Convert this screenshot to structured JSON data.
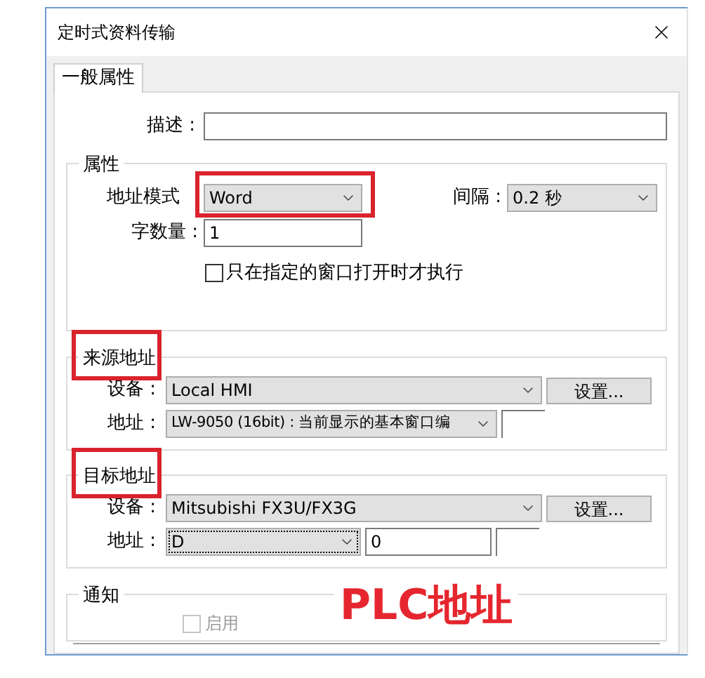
{
  "window": {
    "title": "定时式资料传输"
  },
  "tabs": [
    {
      "label": "一般属性",
      "selected": true
    }
  ],
  "description": {
    "label": "描述 :"
  },
  "properties": {
    "title": "属性",
    "address_mode": {
      "label": "地址模式",
      "value": "Word",
      "highlighted": true
    },
    "interval": {
      "label": "间隔 :",
      "value": "0.2 秒"
    },
    "word_count": {
      "label": "字数量 :",
      "value": "1"
    },
    "window_only": {
      "label": "只在指定的窗口打开时才执行",
      "checked": false
    }
  },
  "source": {
    "title": "来源地址",
    "highlighted": true,
    "device": {
      "label": "设备 :",
      "value": "Local HMI",
      "button": "设置..."
    },
    "address": {
      "label": "地址 :",
      "value": "LW-9050 (16bit) : 当前显示的基本窗口编"
    }
  },
  "target": {
    "title": "目标地址",
    "highlighted": true,
    "device": {
      "label": "设备 :",
      "value": "Mitsubishi FX3U/FX3G",
      "button": "设置..."
    },
    "address": {
      "label": "地址 :",
      "type": "D",
      "value": "0"
    }
  },
  "notify": {
    "title": "通知",
    "enable": {
      "label": "启用",
      "checked": false,
      "disabled": true
    }
  },
  "annotation": {
    "text": "PLC地址"
  }
}
